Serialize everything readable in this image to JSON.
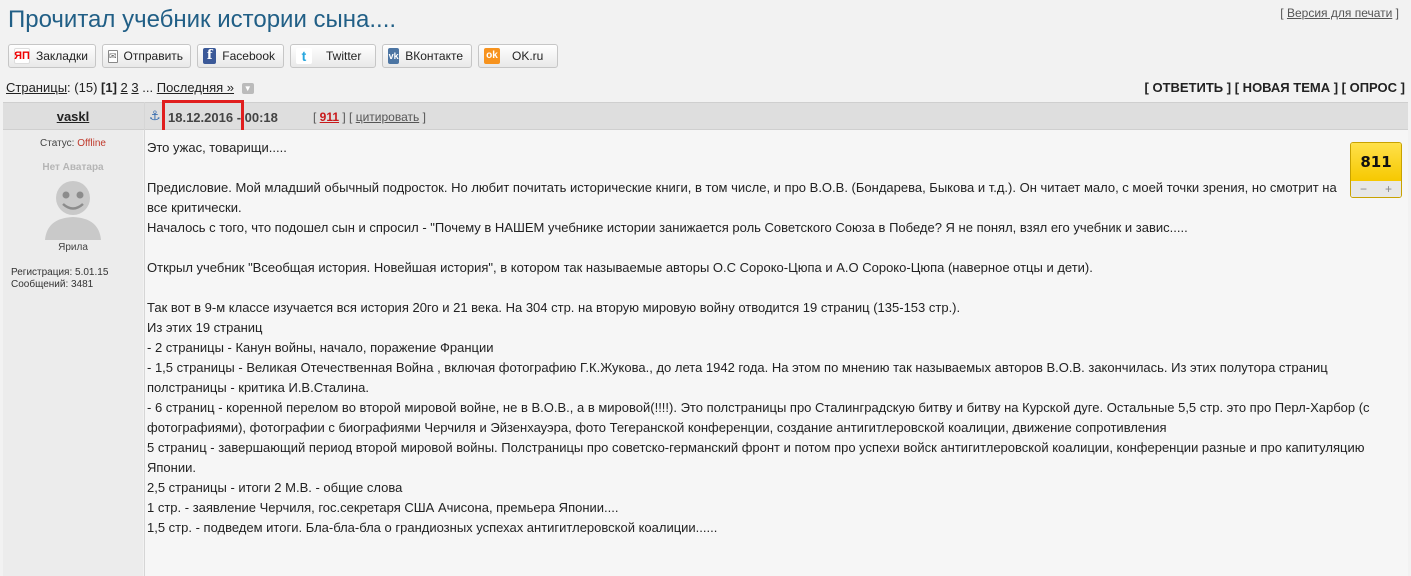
{
  "header": {
    "title": "Прочитал учебник истории сына....",
    "print_version": "Версия для печати"
  },
  "share": [
    {
      "label": "Закладки",
      "icon": "yandex-bookmarks-icon",
      "glyph": "ЯП"
    },
    {
      "label": "Отправить",
      "icon": "mail-icon",
      "glyph": "✉"
    },
    {
      "label": "Facebook",
      "icon": "facebook-icon",
      "glyph": "f"
    },
    {
      "label": "Twitter",
      "icon": "twitter-icon",
      "glyph": "t"
    },
    {
      "label": "ВКонтакте",
      "icon": "vkontakte-icon",
      "glyph": "vk"
    },
    {
      "label": "OK.ru",
      "icon": "odnoklassniki-icon",
      "glyph": "ok"
    }
  ],
  "pagination": {
    "label": "Страницы",
    "count": "(15)",
    "current": "[1]",
    "p2": "2",
    "p3": "3",
    "ellipsis": "...",
    "last": "Последняя »"
  },
  "actions": {
    "reply": "[ ОТВЕТИТЬ ]",
    "new_topic": "[ НОВАЯ ТЕМА ]",
    "poll": "[ ОПРОС ]"
  },
  "post": {
    "author": "vaskl",
    "status_label": "Статус:",
    "status_value": "Offline",
    "avatar_text": "Нет Аватара",
    "avatar_name": "Ярила",
    "registration": "Регистрация: 5.01.15",
    "messages": "Сообщений: 3481",
    "date": "18.12.2016",
    "time": " - 00:18",
    "post_number": "911",
    "quote": "цитировать",
    "rating": "811",
    "rating_minus": "−",
    "rating_plus": "+",
    "lines": [
      "Это ужас, товарищи.....",
      "",
      "Предисловие. Мой младший обычный подросток. Но любит почитать исторические книги, в том числе, и про В.О.В. (Бондарева, Быкова и т.д.). Он читает мало, с моей точки зрения, но смотрит на все критически.",
      "Началось с того, что подошел сын и спросил - \"Почему в НАШЕМ учебнике истории занижается роль Советского Союза в Победе? Я не понял, взял его учебник и завис.....",
      "",
      "Открыл учебник \"Всеобщая история. Новейшая история\", в котором так называемые авторы О.С Сороко-Цюпа и А.О Сороко-Цюпа (наверное отцы и дети).",
      "",
      "Так вот в 9-м классе изучается вся история 20го и 21 века. На 304 стр. на вторую мировую войну отводится 19 страниц (135-153 стр.).",
      "Из этих 19 страниц",
      "- 2 страницы - Канун войны, начало, поражение Франции",
      "- 1,5 страницы - Великая Отечественная Война , включая фотографию Г.К.Жукова., до лета 1942 года. На этом по мнению так называемых авторов В.О.В. закончилась. Из этих полутора страниц полстраницы - критика И.В.Сталина.",
      "- 6 страниц - коренной перелом во второй мировой войне, не в В.О.В., а в мировой(!!!!). Это полстраницы про Сталинградскую битву и битву на Курской дуге. Остальные 5,5 стр. это про Перл-Харбор (с фотографиями), фотографии с биографиями Черчиля и Эйзенхауэра, фото Тегеранской конференции, создание антигитлеровской коалиции, движение сопротивления",
      "5 страниц - завершающий период второй мировой войны. Полстраницы про советско-германский фронт и потом про успехи войск антигитлеровской коалиции, конференции разные и про капитуляцию Японии.",
      "2,5 страницы - итоги 2 М.В. - общие слова",
      "1 стр. - заявление Черчиля, гос.секретаря США Ачисона, премьера Японии....",
      "1,5 стр. - подведем итоги. Бла-бла-бла о грандиозных успехах антигитлеровской коалиции......"
    ]
  }
}
